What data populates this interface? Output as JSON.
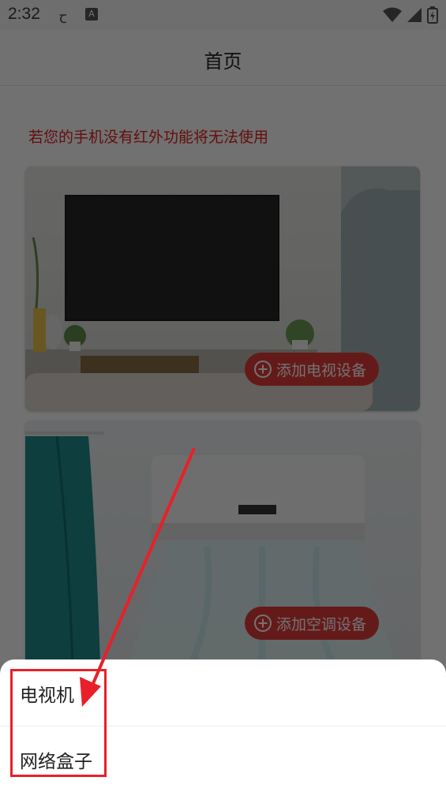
{
  "status_bar": {
    "time": "2:32",
    "icons": [
      "app-notification-icon",
      "a-badge-icon",
      "wifi-icon",
      "cellular-signal-icon",
      "battery-charging-icon"
    ],
    "a_badge": "A"
  },
  "header": {
    "title": "首页"
  },
  "main": {
    "warning": "若您的手机没有红外功能将无法使用",
    "warning_color": "#e02020",
    "cards": [
      {
        "image": "tv-room-illustration",
        "button_label": "添加电视设备"
      },
      {
        "image": "air-conditioner-illustration",
        "button_label": "添加空调设备"
      }
    ]
  },
  "bottom_sheet": {
    "items": [
      {
        "label": "电视机"
      },
      {
        "label": "网络盒子"
      }
    ]
  },
  "annotation": {
    "color": "#e8202a"
  }
}
